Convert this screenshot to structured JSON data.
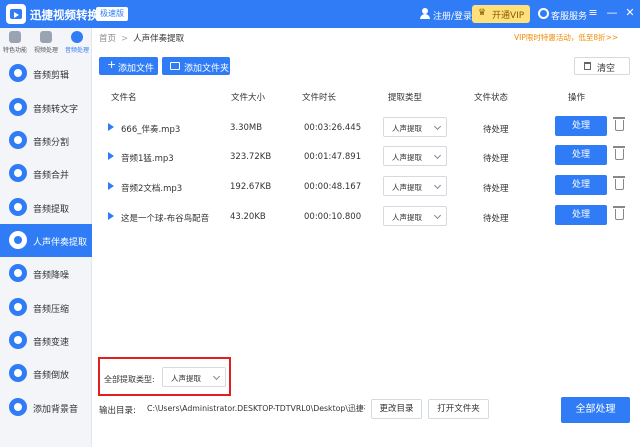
{
  "app": {
    "title": "迅捷视频转换器",
    "edition": "极速版",
    "login": "注册/登录",
    "vip_button": "开通VIP",
    "customer_service": "客服服务"
  },
  "window_controls": [
    "≡",
    "—",
    "✕"
  ],
  "top_tabs": [
    {
      "label": "特色功能",
      "icon": "star-icon"
    },
    {
      "label": "视频处理",
      "icon": "video-icon"
    },
    {
      "label": "音频处理",
      "icon": "audio-icon"
    }
  ],
  "sidebar": {
    "items": [
      {
        "label": "音频剪辑",
        "active": false
      },
      {
        "label": "音频转文字",
        "active": false
      },
      {
        "label": "音频分割",
        "active": false
      },
      {
        "label": "音频合并",
        "active": false
      },
      {
        "label": "音频提取",
        "active": false
      },
      {
        "label": "人声伴奏提取",
        "active": true
      },
      {
        "label": "音频降噪",
        "active": false
      },
      {
        "label": "音频压缩",
        "active": false
      },
      {
        "label": "音频变速",
        "active": false
      },
      {
        "label": "音频倒放",
        "active": false
      },
      {
        "label": "添加背景音",
        "active": false
      }
    ]
  },
  "breadcrumb": {
    "home": "首页",
    "separator": ">",
    "current": "人声伴奏提取"
  },
  "notice": "VIP限时特惠活动，低至8折>>",
  "toolbar": {
    "add_file": "添加文件",
    "add_folder": "添加文件夹",
    "clear": "清空"
  },
  "table": {
    "headers": [
      "文件名",
      "文件大小",
      "文件时长",
      "提取类型",
      "文件状态",
      "操作"
    ],
    "rows": [
      {
        "name": "666_伴奏.mp3",
        "size": "3.30MB",
        "duration": "00:03:26.445",
        "type": "人声提取",
        "status": "待处理",
        "action": "处理"
      },
      {
        "name": "音频1猛.mp3",
        "size": "323.72KB",
        "duration": "00:01:47.891",
        "type": "人声提取",
        "status": "待处理",
        "action": "处理"
      },
      {
        "name": "音频2文档.mp3",
        "size": "192.67KB",
        "duration": "00:00:48.167",
        "type": "人声提取",
        "status": "待处理",
        "action": "处理"
      },
      {
        "name": "这是一个球-布谷鸟配音",
        "size": "43.20KB",
        "duration": "00:00:10.800",
        "type": "人声提取",
        "status": "待处理",
        "action": "处理"
      }
    ]
  },
  "bulk": {
    "label": "全部提取类型:",
    "value": "人声提取"
  },
  "output": {
    "label": "输出目录:",
    "path": "C:\\Users\\Administrator.DESKTOP-TDTVRL0\\Desktop\\迅捷视...",
    "change_button": "更改目录",
    "open_button": "打开文件夹"
  },
  "process_all": "全部处理",
  "colors": {
    "accent": "#2f7cf6",
    "highlight_border": "#e02020",
    "notice": "#f08a00"
  }
}
